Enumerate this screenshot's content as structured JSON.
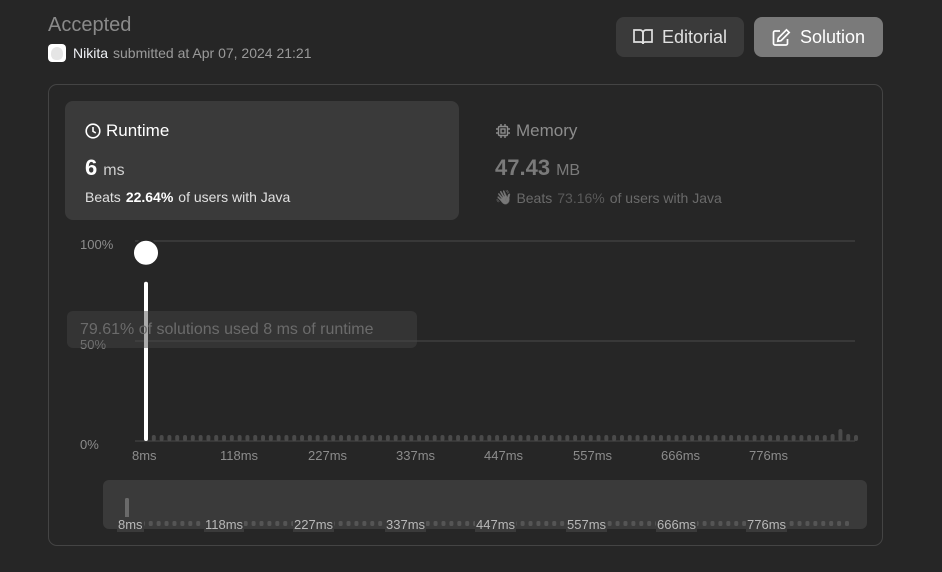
{
  "header": {
    "status": "Accepted",
    "username": "Nikita",
    "submitted_text": "submitted at Apr 07, 2024 21:21"
  },
  "buttons": {
    "editorial": "Editorial",
    "solution": "Solution"
  },
  "runtime": {
    "title": "Runtime",
    "value": "6",
    "unit": "ms",
    "beats_prefix": "Beats",
    "beats_pct": "22.64%",
    "beats_suffix": "of users with Java"
  },
  "memory": {
    "title": "Memory",
    "value": "47.43",
    "unit": "MB",
    "beats_prefix": "Beats",
    "beats_pct": "73.16%",
    "beats_suffix": "of users with Java"
  },
  "tooltip": "79.61% of solutions used 8 ms of runtime",
  "chart_data": {
    "type": "bar",
    "title": "",
    "xlabel": "",
    "ylabel": "",
    "y_tick_labels": [
      "100%",
      "50%",
      "0%"
    ],
    "ylim": [
      0,
      100
    ],
    "x_tick_labels": [
      "8ms",
      "118ms",
      "227ms",
      "337ms",
      "447ms",
      "557ms",
      "666ms",
      "776ms"
    ],
    "grid": true,
    "highlight_index": 0,
    "values": [
      79.61,
      1.5,
      1.5,
      1.5,
      1.5,
      1.5,
      1.5,
      1.5,
      1.5,
      1.5,
      1.5,
      1.5,
      1.5,
      1.5,
      1.5,
      1.5,
      1.5,
      1.5,
      1.5,
      1.5,
      1.5,
      1.5,
      1.5,
      1.5,
      1.5,
      1.5,
      1.5,
      1.5,
      1.5,
      1.5,
      1.5,
      1.5,
      1.5,
      1.5,
      1.5,
      1.5,
      1.5,
      1.5,
      1.5,
      1.5,
      1.5,
      1.5,
      1.5,
      1.5,
      1.5,
      1.5,
      1.5,
      1.5,
      1.5,
      1.5,
      1.5,
      1.5,
      1.5,
      1.5,
      1.5,
      1.5,
      1.5,
      1.5,
      1.5,
      1.5,
      1.5,
      1.5,
      1.5,
      1.5,
      1.5,
      1.5,
      1.5,
      1.5,
      1.5,
      1.5,
      1.5,
      1.5,
      1.5,
      1.5,
      1.5,
      1.5,
      1.5,
      1.5,
      1.5,
      1.5,
      1.5,
      1.5,
      1.5,
      1.5,
      1.5,
      1.5,
      1.5,
      1.5,
      3.5,
      6,
      3.5,
      3
    ]
  },
  "range_selector": {
    "labels": [
      "8ms",
      "118ms",
      "227ms",
      "337ms",
      "447ms",
      "557ms",
      "666ms",
      "776ms"
    ]
  },
  "colors": {
    "accent_bar": "#ffffff",
    "bar": "#4a4a4a",
    "grid": "#4a4a4a"
  }
}
